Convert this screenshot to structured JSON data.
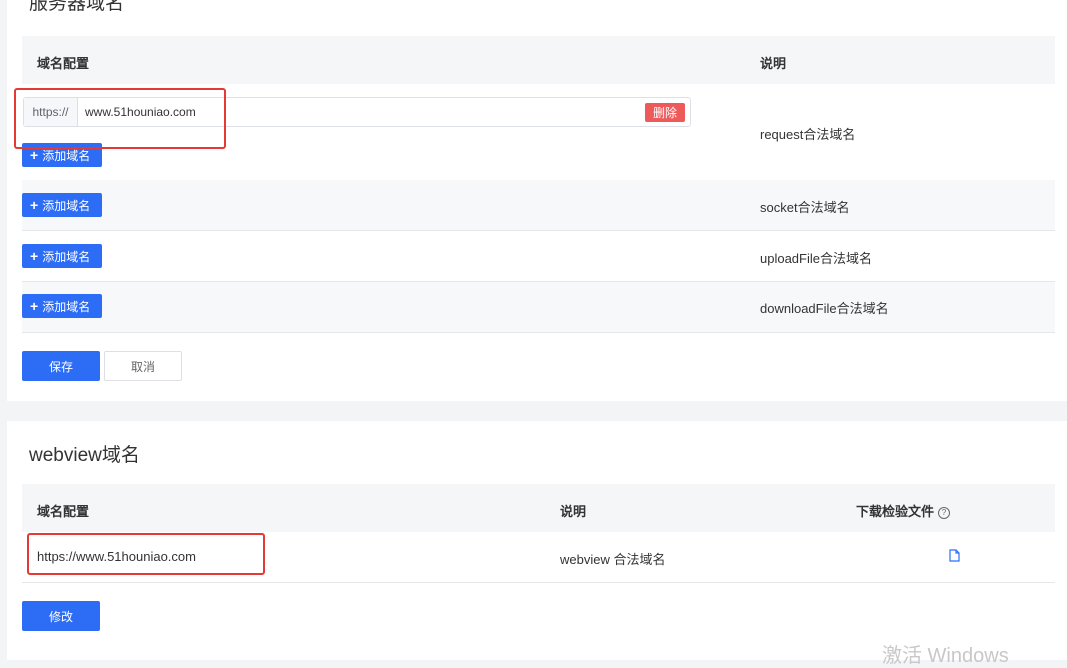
{
  "server_domain": {
    "title": "服务器域名",
    "table_headers": {
      "domain_config": "域名配置",
      "description": "说明"
    },
    "rows": [
      {
        "description": "request合法域名",
        "input": {
          "prefix": "https://",
          "value": "www.51houniao.com",
          "delete_label": "删除"
        },
        "add_label": "添加域名"
      },
      {
        "description": "socket合法域名",
        "add_label": "添加域名"
      },
      {
        "description": "uploadFile合法域名",
        "add_label": "添加域名"
      },
      {
        "description": "downloadFile合法域名",
        "add_label": "添加域名"
      }
    ],
    "save_label": "保存",
    "cancel_label": "取消"
  },
  "webview": {
    "title": "webview域名",
    "table_headers": {
      "domain_config": "域名配置",
      "description": "说明",
      "download": "下载检验文件",
      "help_glyph": "?"
    },
    "row": {
      "domain": "https://www.51houniao.com",
      "description": "webview 合法域名",
      "file_icon": "file-icon"
    },
    "edit_label": "修改"
  },
  "watermark": "激活 Windows",
  "colors": {
    "primary": "#2d6df6",
    "danger": "#ee5a5a",
    "highlight": "#e53935",
    "header_bg": "#f5f6f8"
  }
}
